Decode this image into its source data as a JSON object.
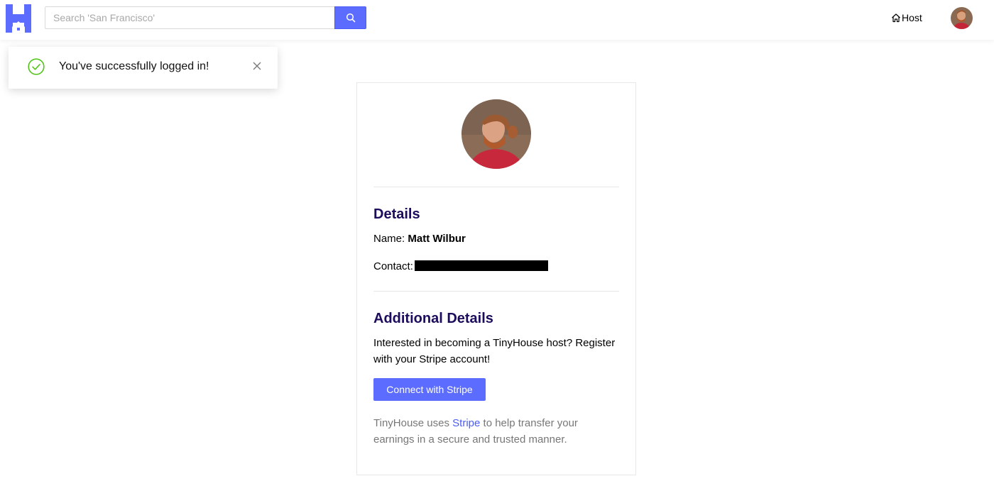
{
  "header": {
    "search": {
      "placeholder": "Search 'San Francisco'",
      "value": ""
    },
    "host_label": "Host"
  },
  "toast": {
    "message": "You've successfully logged in!"
  },
  "profile": {
    "details_title": "Details",
    "name_label": "Name:",
    "name_value": "Matt Wilbur",
    "contact_label": "Contact:",
    "additional_title": "Additional Details",
    "host_prompt": "Interested in becoming a TinyHouse host? Register with your Stripe account!",
    "connect_button": "Connect with Stripe",
    "note_prefix": "TinyHouse uses ",
    "note_link": "Stripe",
    "note_suffix": " to help transfer your earnings in a secure and trusted manner."
  },
  "colors": {
    "brand": "#5b6cff",
    "title": "#1d0c5c",
    "success": "#52c41a",
    "muted": "#777777"
  },
  "icons": [
    "logo-icon",
    "search-icon",
    "home-icon",
    "check-circle-icon",
    "close-icon"
  ]
}
